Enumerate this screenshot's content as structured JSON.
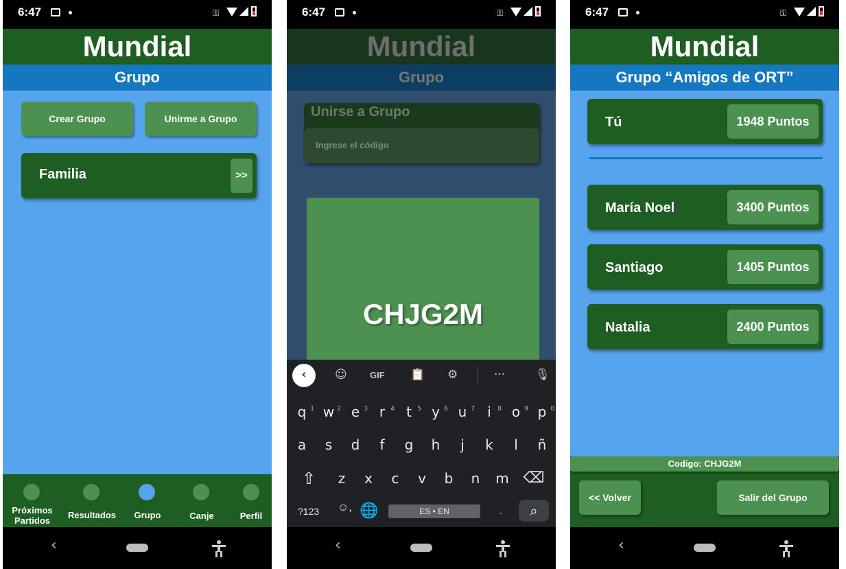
{
  "status": {
    "time": "6:47"
  },
  "app": {
    "title": "Mundial",
    "section": "Grupo"
  },
  "screen1": {
    "create_label": "Crear Grupo",
    "join_label": "Unirme a Grupo",
    "group_name": "Familia",
    "group_arrow": ">>",
    "nav": [
      "Próximos\nPartidos",
      "Resultados",
      "Grupo",
      "Canje",
      "Perfil"
    ],
    "nav_active": "Grupo"
  },
  "screen2": {
    "dialog_title": "Unirse a Grupo",
    "input_placeholder": "Ingrese el código",
    "code": "CHJG2M",
    "keyboard": {
      "toolbar_gif": "GIF",
      "row1": [
        "q",
        "w",
        "e",
        "r",
        "t",
        "y",
        "u",
        "i",
        "o",
        "p"
      ],
      "row1_hints": [
        "1",
        "2",
        "3",
        "4",
        "5",
        "6",
        "7",
        "8",
        "9",
        "0"
      ],
      "row2": [
        "a",
        "s",
        "d",
        "f",
        "g",
        "h",
        "j",
        "k",
        "l",
        "ñ"
      ],
      "row3": [
        "z",
        "x",
        "c",
        "v",
        "b",
        "n",
        "m"
      ],
      "symbols_label": "?123",
      "comma": ",",
      "period": ".",
      "space_label": "ES • EN"
    }
  },
  "screen3": {
    "group_title": "Grupo “Amigos de ORT”",
    "self": {
      "name": "Tú",
      "points": "1948 Puntos"
    },
    "members": [
      {
        "name": "María Noel",
        "points": "3400 Puntos"
      },
      {
        "name": "Santiago",
        "points": "1405 Puntos"
      },
      {
        "name": "Natalia",
        "points": "2400 Puntos"
      }
    ],
    "code_label": "Codigo: CHJG2M",
    "back_label": "<< Volver",
    "leave_label": "Salir del Grupo"
  },
  "colors": {
    "primary_green": "#1e5e22",
    "accent_green": "#4d9150",
    "blue_bar": "#1477c0",
    "bg_blue": "#57a4ee"
  }
}
